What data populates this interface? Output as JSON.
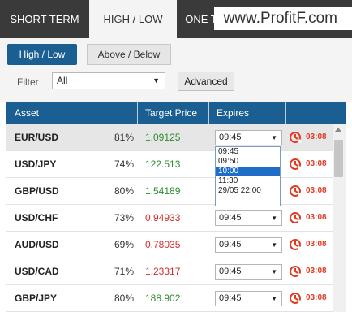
{
  "top_tabs": [
    {
      "label": "SHORT TERM"
    },
    {
      "label": "HIGH / LOW"
    },
    {
      "label": "ONE T"
    }
  ],
  "watermark": "www.ProfitF.com",
  "subtabs": {
    "high_low": "High / Low",
    "above_below": "Above / Below"
  },
  "filter": {
    "label": "Filter",
    "value": "All",
    "advanced": "Advanced"
  },
  "table_headers": {
    "asset": "Asset",
    "target_price": "Target Price",
    "expires": "Expires"
  },
  "rows": [
    {
      "asset": "EUR/USD",
      "pct": "81%",
      "price": "1.09125",
      "expires": "09:45",
      "countdown": "03:08"
    },
    {
      "asset": "USD/JPY",
      "pct": "74%",
      "price": "122.513",
      "expires": "09:45",
      "countdown": "03:08"
    },
    {
      "asset": "GBP/USD",
      "pct": "80%",
      "price": "1.54189",
      "expires": "09:45",
      "countdown": "03:08"
    },
    {
      "asset": "USD/CHF",
      "pct": "73%",
      "price": "0.94933",
      "expires": "09:45",
      "countdown": "03:08"
    },
    {
      "asset": "AUD/USD",
      "pct": "69%",
      "price": "0.78035",
      "expires": "09:45",
      "countdown": "03:08"
    },
    {
      "asset": "USD/CAD",
      "pct": "71%",
      "price": "1.23317",
      "expires": "09:45",
      "countdown": "03:08"
    },
    {
      "asset": "GBP/JPY",
      "pct": "80%",
      "price": "188.902",
      "expires": "09:45",
      "countdown": "03:08"
    }
  ],
  "expiry_options": [
    "09:45",
    "09:50",
    "10:00",
    "11:30",
    "29/05 22:00"
  ],
  "colors": {
    "accent": "#1b5f92",
    "up": "#2e8b2e",
    "down": "#d32f2f",
    "countdown": "#e03c23"
  }
}
